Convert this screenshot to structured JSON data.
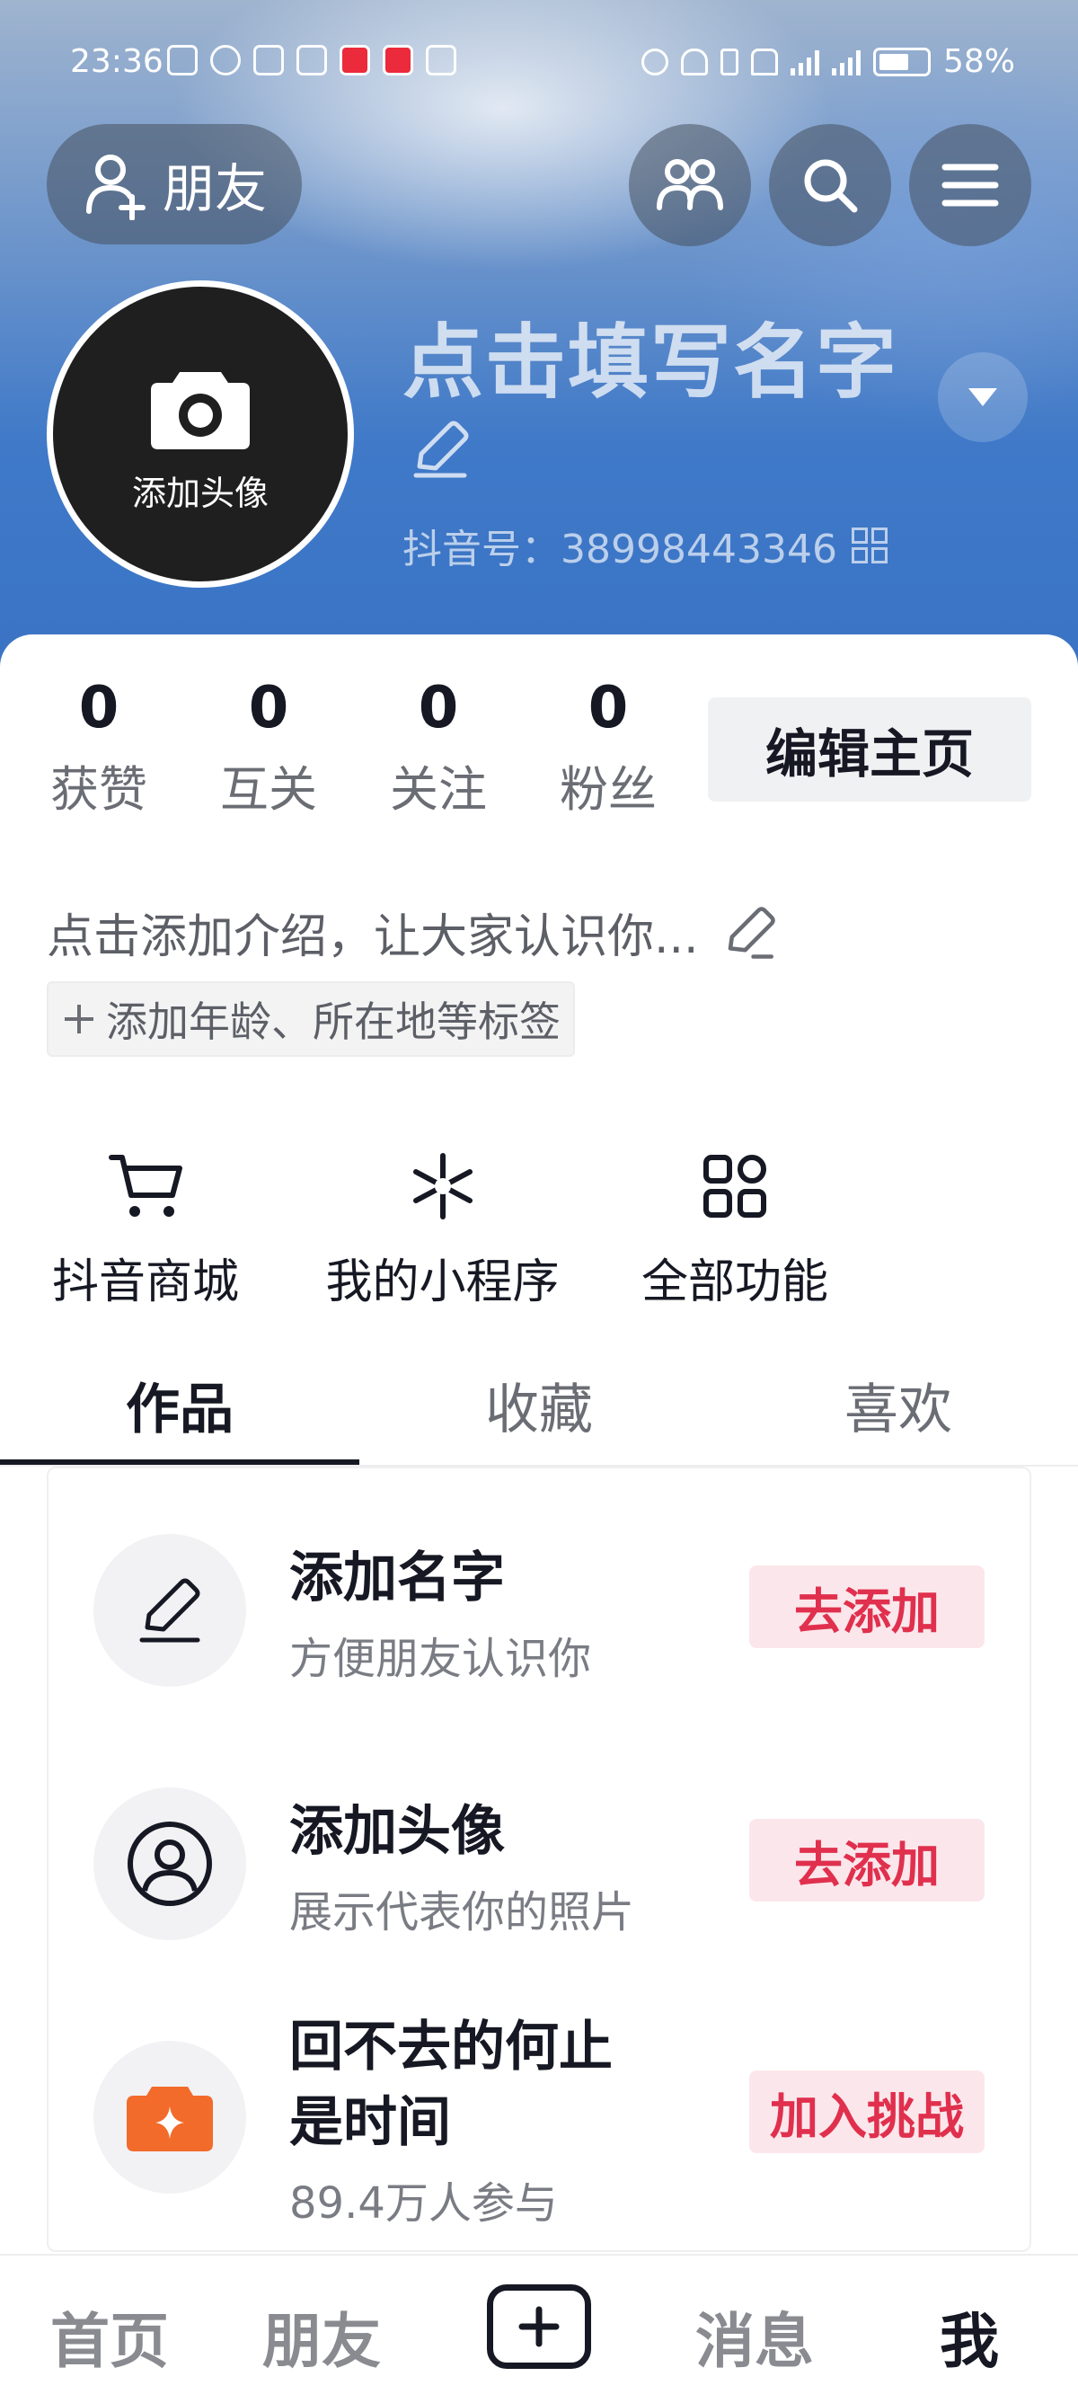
{
  "status_bar": {
    "time": "23:36",
    "battery": "58%"
  },
  "header": {
    "friend_button": "朋友"
  },
  "profile": {
    "avatar_label": "添加头像",
    "name": "点击填写名字",
    "douyin_id": "抖音号：38998443346"
  },
  "stats": [
    {
      "value": "0",
      "label": "获赞"
    },
    {
      "value": "0",
      "label": "互关"
    },
    {
      "value": "0",
      "label": "关注"
    },
    {
      "value": "0",
      "label": "粉丝"
    }
  ],
  "edit_home_label": "编辑主页",
  "intro": "点击添加介绍，让大家认识你...",
  "tag_add": "添加年龄、所在地等标签",
  "functions": [
    {
      "label": "抖音商城",
      "icon": "cart-icon"
    },
    {
      "label": "我的小程序",
      "icon": "asterisk-icon"
    },
    {
      "label": "全部功能",
      "icon": "grid-icon"
    }
  ],
  "tabs": [
    "作品",
    "收藏",
    "喜欢"
  ],
  "tasks": [
    {
      "title": "添加名字",
      "subtitle": "方便朋友认识你",
      "action": "去添加",
      "icon": "pen-icon"
    },
    {
      "title": "添加头像",
      "subtitle": "展示代表你的照片",
      "action": "去添加",
      "icon": "person-icon"
    },
    {
      "title_line1": "回不去的何止",
      "title_line2": "是时间",
      "subtitle": "89.4万人参与",
      "action": "加入挑战",
      "icon": "challenge-icon"
    }
  ],
  "bottom_nav": {
    "home": "首页",
    "friends": "朋友",
    "messages": "消息",
    "me": "我"
  },
  "colors": {
    "accent": "#e0304e",
    "accent_bg": "#fbe7eb",
    "text": "#161823"
  }
}
